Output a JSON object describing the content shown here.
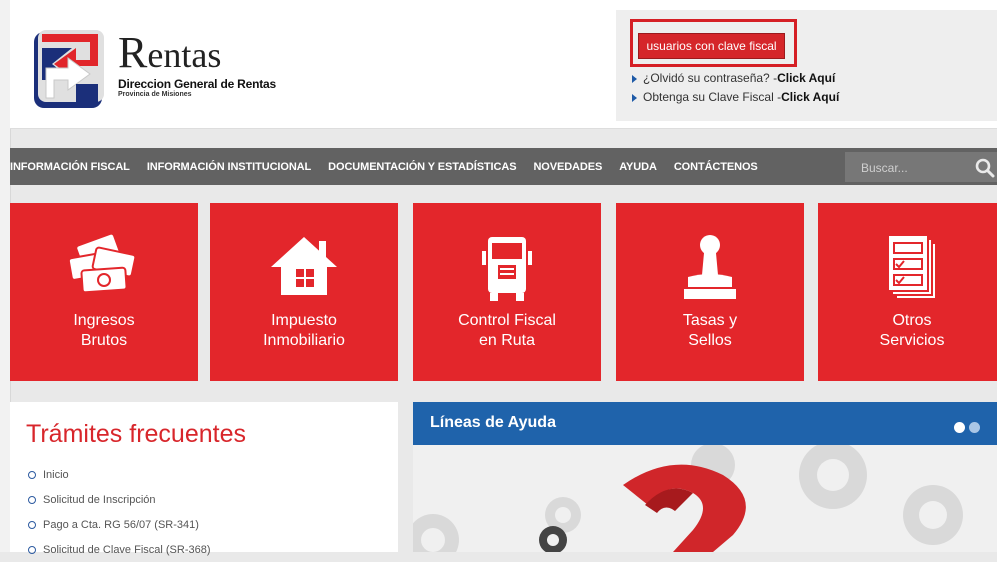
{
  "header": {
    "brand_initial": "R",
    "brand_rest": "entas",
    "org_name": "Direccion General de Rentas",
    "province": "Provincia de Misiones"
  },
  "login": {
    "button_label": "usuarios con clave fiscal",
    "forgot_text": "¿Olvidó su contraseña? - ",
    "forgot_link": "Click Aquí",
    "obtain_text": "Obtenga su Clave Fiscal - ",
    "obtain_link": "Click Aquí"
  },
  "nav": {
    "items": [
      "INFORMACIÓN FISCAL",
      "INFORMACIÓN INSTITUCIONAL",
      "DOCUMENTACIÓN Y ESTADÍSTICAS",
      "NOVEDADES",
      "AYUDA",
      "CONTÁCTENOS"
    ],
    "search_placeholder": "Buscar..."
  },
  "tiles": [
    {
      "line1": "Ingresos",
      "line2": "Brutos",
      "icon": "money-icon"
    },
    {
      "line1": "Impuesto",
      "line2": "Inmobiliario",
      "icon": "house-icon"
    },
    {
      "line1": "Control Fiscal",
      "line2": "en Ruta",
      "icon": "truck-icon"
    },
    {
      "line1": "Tasas y",
      "line2": "Sellos",
      "icon": "stamp-icon"
    },
    {
      "line1": "Otros",
      "line2": "Servicios",
      "icon": "documents-icon"
    }
  ],
  "tramites": {
    "title": "Trámites frecuentes",
    "items": [
      "Inicio",
      "Solicitud de Inscripción",
      "Pago a Cta. RG 56/07 (SR-341)",
      "Solicitud de Clave Fiscal (SR-368)"
    ]
  },
  "ayuda": {
    "title": "Líneas de Ayuda"
  },
  "colors": {
    "brand_red": "#e3262b",
    "nav_gray": "#626262",
    "help_blue": "#1f63ab"
  }
}
